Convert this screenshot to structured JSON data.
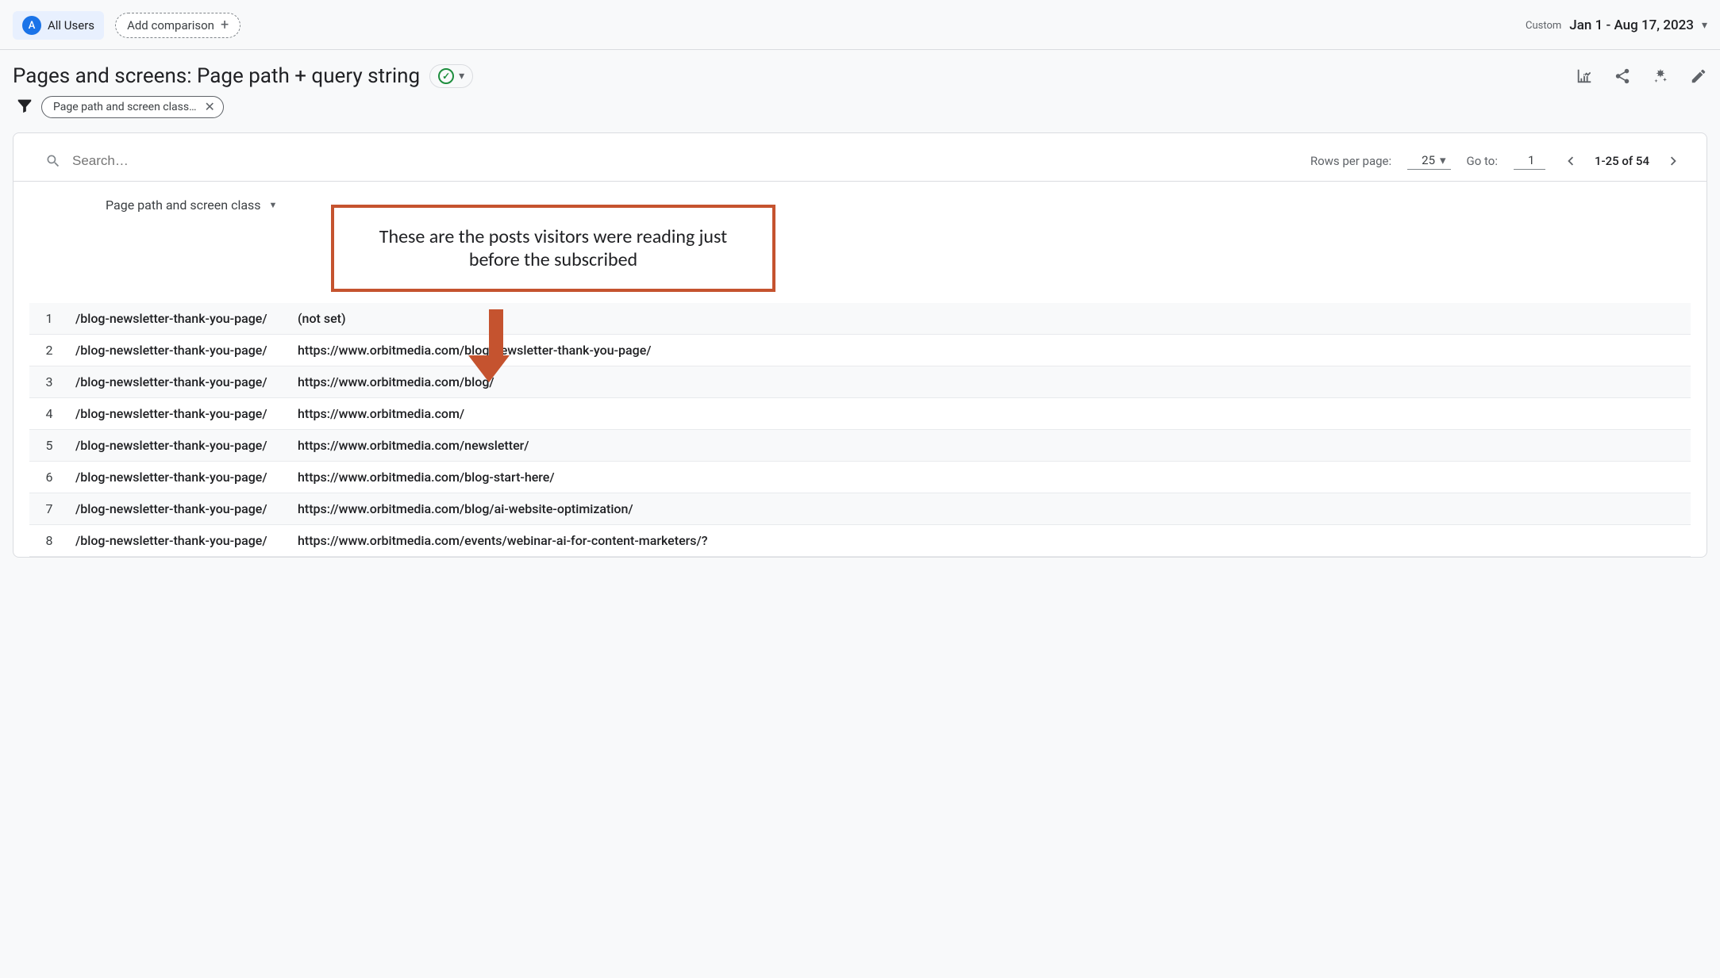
{
  "topbar": {
    "audience": "All Users",
    "audience_letter": "A",
    "add_comparison": "Add comparison",
    "date_range_type": "Custom",
    "date_range": "Jan 1 - Aug 17, 2023"
  },
  "title": {
    "text": "Pages and screens: Page path + query string"
  },
  "filter": {
    "chip_text": "Page path and screen class…"
  },
  "table": {
    "search_placeholder": "Search…",
    "rows_per_page_label": "Rows per page:",
    "rows_per_page_value": "25",
    "goto_label": "Go to:",
    "goto_value": "1",
    "range_text": "1-25 of 54",
    "dimension_header": "Page path and screen class",
    "rows": [
      {
        "n": "1",
        "path": "/blog-newsletter-thank-you-page/",
        "ref": "(not set)"
      },
      {
        "n": "2",
        "path": "/blog-newsletter-thank-you-page/",
        "ref": "https://www.orbitmedia.com/blog-newsletter-thank-you-page/"
      },
      {
        "n": "3",
        "path": "/blog-newsletter-thank-you-page/",
        "ref": "https://www.orbitmedia.com/blog/"
      },
      {
        "n": "4",
        "path": "/blog-newsletter-thank-you-page/",
        "ref": "https://www.orbitmedia.com/"
      },
      {
        "n": "5",
        "path": "/blog-newsletter-thank-you-page/",
        "ref": "https://www.orbitmedia.com/newsletter/"
      },
      {
        "n": "6",
        "path": "/blog-newsletter-thank-you-page/",
        "ref": "https://www.orbitmedia.com/blog-start-here/"
      },
      {
        "n": "7",
        "path": "/blog-newsletter-thank-you-page/",
        "ref": "https://www.orbitmedia.com/blog/ai-website-optimization/"
      },
      {
        "n": "8",
        "path": "/blog-newsletter-thank-you-page/",
        "ref": "https://www.orbitmedia.com/events/webinar-ai-for-content-marketers/?"
      }
    ]
  },
  "annotation": {
    "text": "These are the posts visitors were reading just before the subscribed"
  }
}
